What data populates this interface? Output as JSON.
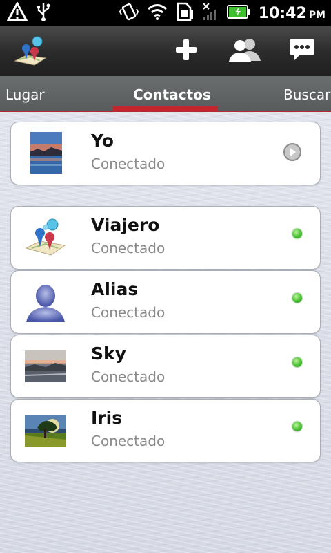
{
  "status_bar": {
    "time": "10:42",
    "ampm": "PM",
    "icons": [
      "warning-icon",
      "usb-icon",
      "vibrate-icon",
      "wifi-icon",
      "sim-icon",
      "no-signal-icon",
      "battery-charging-icon"
    ]
  },
  "action_bar": {
    "icons": [
      "app-logo-icon",
      "add-icon",
      "group-icon",
      "chat-icon"
    ]
  },
  "tabs": [
    {
      "label": "Lugar"
    },
    {
      "label": "Contactos"
    },
    {
      "label": "Buscar"
    }
  ],
  "me": {
    "name": "Yo",
    "status": "Conectado"
  },
  "contacts": [
    {
      "name": "Viajero",
      "status": "Conectado"
    },
    {
      "name": "Alias",
      "status": "Conectado"
    },
    {
      "name": "Sky",
      "status": "Conectado"
    },
    {
      "name": "Iris",
      "status": "Conectado"
    }
  ],
  "colors": {
    "accent_red": "#c0262b",
    "online_green": "#49c131"
  }
}
